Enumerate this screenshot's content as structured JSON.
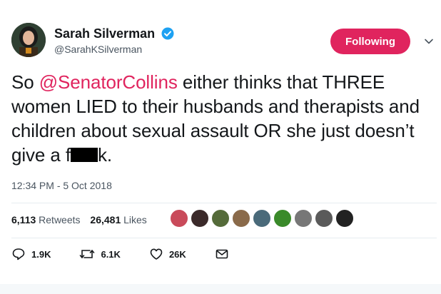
{
  "author": {
    "display_name": "Sarah Silverman",
    "handle": "@SarahKSilverman",
    "verified": true
  },
  "follow_button": {
    "label": "Following"
  },
  "tweet": {
    "text_before": "So ",
    "mention": "@SenatorCollins",
    "text_after": " either thinks that THREE women LIED to their husbands and therapists and children about sexual assault OR she just doesn’t give a f",
    "text_end": "k."
  },
  "timestamp": "12:34 PM - 5 Oct 2018",
  "stats": {
    "retweets_count": "6,113",
    "retweets_label": "Retweets",
    "likes_count": "26,481",
    "likes_label": "Likes"
  },
  "actions": {
    "reply_count": "1.9K",
    "retweet_count": "6.1K",
    "like_count": "26K"
  },
  "colors": {
    "accent": "#e0245e",
    "verified": "#1da1f2",
    "text": "#14171a",
    "muted": "#4a5560"
  },
  "icons": [
    "verified-badge-icon",
    "chevron-down-icon",
    "reply-icon",
    "retweet-icon",
    "like-icon",
    "dm-icon"
  ]
}
